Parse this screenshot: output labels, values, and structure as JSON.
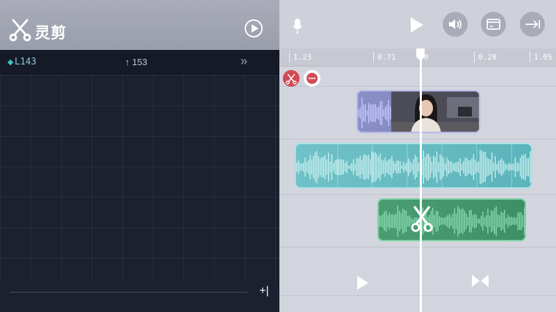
{
  "app": {
    "title": "灵剪",
    "icons": {
      "logo": "scissors-icon",
      "play": "play-circle-icon"
    }
  },
  "left_panel": {
    "info": {
      "left_text": "L143",
      "mid_text": "↑ 153",
      "right_text": "»"
    },
    "bottom_button": "+|"
  },
  "right_panel": {
    "toolbar": {
      "icons": [
        "mic-icon",
        "play-icon",
        "volume-icon",
        "window-icon",
        "exit-icon"
      ]
    },
    "ruler_ticks": [
      "1.23",
      "0.71",
      "0",
      "0.28",
      "1.05"
    ],
    "mini_buttons": [
      "scissors-icon",
      "more-icon"
    ],
    "bottom_controls": [
      "play-icon",
      "bowtie-icon"
    ]
  },
  "colors": {
    "left_bg": "#1c2130",
    "wave_start": "#7e7fe8",
    "wave_end": "#3fd4c6",
    "cut_red": "#d24a55",
    "clip_teal": "#6fc2c7",
    "clip_green": "#4a9d72",
    "clip_violet": "#8b8fc7"
  }
}
